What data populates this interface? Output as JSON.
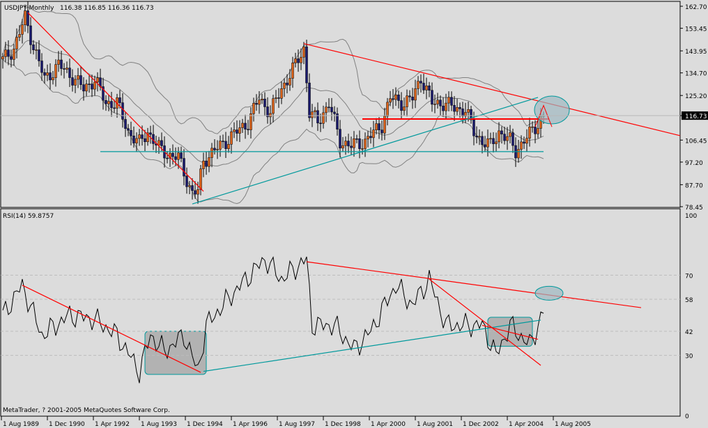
{
  "header": {
    "symbol_label": "USDJPY,Monthly",
    "ohlc": "116.38 116.85 116.36 116.73"
  },
  "rsi_header": {
    "label": "RSI(14) 59.8757"
  },
  "footer": {
    "copyright": "MetaTrader, ? 2001-2005 MetaQuotes Software Corp."
  },
  "colors": {
    "background": "#dcdcdc",
    "bull_candle": "#e0651b",
    "bear_candle": "#1a1a6e",
    "bands": "#808080",
    "red_line": "#ff0000",
    "teal_line": "#00999c",
    "ellipse_fill": "#9fb8c0",
    "box_fill": "#a8a8a8"
  },
  "chart_data": [
    {
      "type": "candlestick",
      "title": "USDJPY,Monthly",
      "ylim": [
        78.45,
        162.7
      ],
      "current_price": "116.73",
      "y_ticks": [
        "162.70",
        "153.45",
        "143.95",
        "134.70",
        "125.20",
        "116.73",
        "106.45",
        "97.20",
        "87.70",
        "78.45"
      ],
      "x_ticks": [
        "1 Aug 1989",
        "1 Dec 1990",
        "1 Apr 1992",
        "1 Aug 1993",
        "1 Dec 1994",
        "1 Apr 1996",
        "1 Aug 1997",
        "1 Dec 1998",
        "1 Apr 2000",
        "1 Aug 2001",
        "1 Dec 2002",
        "1 Apr 2004",
        "1 Aug 2005"
      ],
      "close_keypoints": [
        [
          "1989-08",
          140
        ],
        [
          "1989-12",
          145
        ],
        [
          "1990-04",
          158
        ],
        [
          "1990-07",
          146
        ],
        [
          "1990-11",
          132
        ],
        [
          "1991-04",
          138
        ],
        [
          "1991-09",
          133
        ],
        [
          "1992-01",
          128
        ],
        [
          "1992-05",
          132
        ],
        [
          "1992-09",
          122
        ],
        [
          "1993-01",
          122
        ],
        [
          "1993-05",
          110
        ],
        [
          "1993-09",
          105
        ],
        [
          "1993-12",
          110
        ],
        [
          "1994-04",
          103
        ],
        [
          "1994-08",
          100
        ],
        [
          "1994-11",
          99
        ],
        [
          "1995-04",
          84
        ],
        [
          "1995-06",
          85
        ],
        [
          "1995-08",
          98
        ],
        [
          "1995-12",
          102
        ],
        [
          "1996-06",
          108
        ],
        [
          "1996-12",
          114
        ],
        [
          "1997-04",
          124
        ],
        [
          "1997-08",
          118
        ],
        [
          "1997-12",
          128
        ],
        [
          "1998-05",
          138
        ],
        [
          "1998-08",
          145
        ],
        [
          "1998-10",
          118
        ],
        [
          "1999-01",
          114
        ],
        [
          "1999-05",
          122
        ],
        [
          "1999-09",
          106
        ],
        [
          "2000-01",
          104
        ],
        [
          "2000-06",
          106
        ],
        [
          "2000-12",
          113
        ],
        [
          "2001-03",
          124
        ],
        [
          "2001-08",
          122
        ],
        [
          "2001-11",
          124
        ],
        [
          "2002-02",
          133
        ],
        [
          "2002-06",
          122
        ],
        [
          "2002-10",
          122
        ],
        [
          "2003-02",
          120
        ],
        [
          "2003-06",
          119
        ],
        [
          "2003-09",
          110
        ],
        [
          "2003-12",
          106
        ],
        [
          "2004-03",
          104
        ],
        [
          "2004-06",
          110
        ],
        [
          "2004-10",
          106
        ],
        [
          "2004-12",
          102
        ],
        [
          "2005-03",
          106
        ],
        [
          "2005-07",
          112
        ],
        [
          "2005-10",
          116.73
        ]
      ],
      "bollinger_bands": true,
      "trendlines": [
        {
          "color": "red",
          "from": [
            "1990-05",
            160
          ],
          "to": [
            "1995-08",
            84.9
          ]
        },
        {
          "color": "red",
          "from": [
            "1998-08",
            147
          ],
          "to": [
            "2005-11-far",
            108.3
          ],
          "to_date": "2009-11"
        },
        {
          "color": "red",
          "from": [
            "2000-05",
            115.3
          ],
          "to": [
            "2005-12",
            115.3
          ]
        },
        {
          "color": "teal",
          "from": [
            "1995-04",
            79.6
          ],
          "to": [
            "2005-08",
            124.4
          ]
        },
        {
          "color": "teal",
          "from": [
            "1992-07",
            101.6
          ],
          "to": [
            "2005-10",
            101.6
          ]
        }
      ],
      "ellipse": {
        "center": [
          "2006-01",
          119.1
        ]
      }
    },
    {
      "type": "line",
      "title": "RSI(14) 59.8757",
      "ylim": [
        0,
        100
      ],
      "y_ticks": [
        100,
        70,
        58,
        42,
        30,
        0
      ],
      "rsi_keypoints": [
        [
          "1989-08",
          50
        ],
        [
          "1990-03",
          65
        ],
        [
          "1990-10",
          40
        ],
        [
          "1991-08",
          50
        ],
        [
          "1992-05",
          48
        ],
        [
          "1993-01",
          40
        ],
        [
          "1993-09",
          22
        ],
        [
          "1994-01",
          40
        ],
        [
          "1994-06",
          32
        ],
        [
          "1995-01",
          40
        ],
        [
          "1995-06",
          22
        ],
        [
          "1995-09",
          45
        ],
        [
          "1996-06",
          60
        ],
        [
          "1997-06",
          78
        ],
        [
          "1997-12",
          68
        ],
        [
          "1998-09",
          78
        ],
        [
          "1998-11",
          45
        ],
        [
          "1999-07",
          45
        ],
        [
          "2000-02",
          33
        ],
        [
          "2000-08",
          42
        ],
        [
          "2001-05",
          65
        ],
        [
          "2001-11",
          55
        ],
        [
          "2002-05",
          68
        ],
        [
          "2002-11",
          45
        ],
        [
          "2003-12",
          45
        ],
        [
          "2004-05",
          30
        ],
        [
          "2004-10",
          45
        ],
        [
          "2005-05",
          35
        ],
        [
          "2005-09",
          48
        ],
        [
          "2006-01",
          60
        ]
      ],
      "trendlines": [
        {
          "color": "red",
          "from": [
            "1990-03",
            65
          ],
          "to": [
            "1995-07",
            21.5
          ]
        },
        {
          "color": "red",
          "from": [
            "1998-09",
            76.7
          ],
          "to": [
            "2008-09",
            53.8
          ]
        },
        {
          "color": "teal",
          "from": [
            "1995-08",
            22
          ],
          "to": [
            "2005-09",
            47.6
          ]
        },
        {
          "color": "red",
          "from": [
            "2002-05",
            68
          ],
          "to": [
            "2005-09",
            25
          ]
        },
        {
          "color": "red",
          "from": [
            "2003-12",
            45
          ],
          "to": [
            "2005-08",
            38
          ]
        }
      ],
      "boxes": [
        {
          "from": [
            "1993-11",
            42
          ],
          "to": [
            "1995-09",
            20.5
          ]
        },
        {
          "from": [
            "2004-02",
            49
          ],
          "to": [
            "2005-06",
            34.5
          ]
        }
      ],
      "ellipse": {
        "center": [
          "2005-12",
          61
        ]
      }
    }
  ]
}
